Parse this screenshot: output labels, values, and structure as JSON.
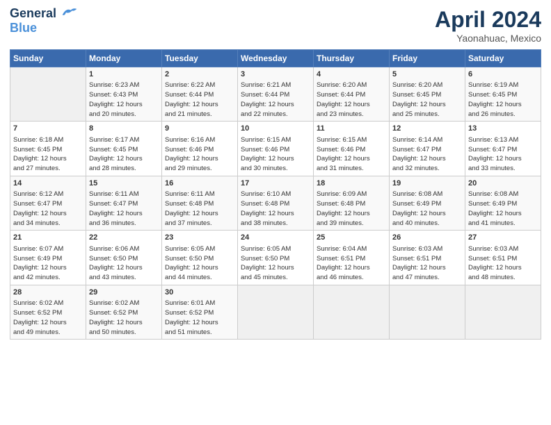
{
  "header": {
    "logo_line1": "General",
    "logo_line2": "Blue",
    "month_title": "April 2024",
    "location": "Yaonahuac, Mexico"
  },
  "days_of_week": [
    "Sunday",
    "Monday",
    "Tuesday",
    "Wednesday",
    "Thursday",
    "Friday",
    "Saturday"
  ],
  "weeks": [
    [
      {
        "day": "",
        "info": ""
      },
      {
        "day": "1",
        "info": "Sunrise: 6:23 AM\nSunset: 6:43 PM\nDaylight: 12 hours\nand 20 minutes."
      },
      {
        "day": "2",
        "info": "Sunrise: 6:22 AM\nSunset: 6:44 PM\nDaylight: 12 hours\nand 21 minutes."
      },
      {
        "day": "3",
        "info": "Sunrise: 6:21 AM\nSunset: 6:44 PM\nDaylight: 12 hours\nand 22 minutes."
      },
      {
        "day": "4",
        "info": "Sunrise: 6:20 AM\nSunset: 6:44 PM\nDaylight: 12 hours\nand 23 minutes."
      },
      {
        "day": "5",
        "info": "Sunrise: 6:20 AM\nSunset: 6:45 PM\nDaylight: 12 hours\nand 25 minutes."
      },
      {
        "day": "6",
        "info": "Sunrise: 6:19 AM\nSunset: 6:45 PM\nDaylight: 12 hours\nand 26 minutes."
      }
    ],
    [
      {
        "day": "7",
        "info": "Sunrise: 6:18 AM\nSunset: 6:45 PM\nDaylight: 12 hours\nand 27 minutes."
      },
      {
        "day": "8",
        "info": "Sunrise: 6:17 AM\nSunset: 6:45 PM\nDaylight: 12 hours\nand 28 minutes."
      },
      {
        "day": "9",
        "info": "Sunrise: 6:16 AM\nSunset: 6:46 PM\nDaylight: 12 hours\nand 29 minutes."
      },
      {
        "day": "10",
        "info": "Sunrise: 6:15 AM\nSunset: 6:46 PM\nDaylight: 12 hours\nand 30 minutes."
      },
      {
        "day": "11",
        "info": "Sunrise: 6:15 AM\nSunset: 6:46 PM\nDaylight: 12 hours\nand 31 minutes."
      },
      {
        "day": "12",
        "info": "Sunrise: 6:14 AM\nSunset: 6:47 PM\nDaylight: 12 hours\nand 32 minutes."
      },
      {
        "day": "13",
        "info": "Sunrise: 6:13 AM\nSunset: 6:47 PM\nDaylight: 12 hours\nand 33 minutes."
      }
    ],
    [
      {
        "day": "14",
        "info": "Sunrise: 6:12 AM\nSunset: 6:47 PM\nDaylight: 12 hours\nand 34 minutes."
      },
      {
        "day": "15",
        "info": "Sunrise: 6:11 AM\nSunset: 6:47 PM\nDaylight: 12 hours\nand 36 minutes."
      },
      {
        "day": "16",
        "info": "Sunrise: 6:11 AM\nSunset: 6:48 PM\nDaylight: 12 hours\nand 37 minutes."
      },
      {
        "day": "17",
        "info": "Sunrise: 6:10 AM\nSunset: 6:48 PM\nDaylight: 12 hours\nand 38 minutes."
      },
      {
        "day": "18",
        "info": "Sunrise: 6:09 AM\nSunset: 6:48 PM\nDaylight: 12 hours\nand 39 minutes."
      },
      {
        "day": "19",
        "info": "Sunrise: 6:08 AM\nSunset: 6:49 PM\nDaylight: 12 hours\nand 40 minutes."
      },
      {
        "day": "20",
        "info": "Sunrise: 6:08 AM\nSunset: 6:49 PM\nDaylight: 12 hours\nand 41 minutes."
      }
    ],
    [
      {
        "day": "21",
        "info": "Sunrise: 6:07 AM\nSunset: 6:49 PM\nDaylight: 12 hours\nand 42 minutes."
      },
      {
        "day": "22",
        "info": "Sunrise: 6:06 AM\nSunset: 6:50 PM\nDaylight: 12 hours\nand 43 minutes."
      },
      {
        "day": "23",
        "info": "Sunrise: 6:05 AM\nSunset: 6:50 PM\nDaylight: 12 hours\nand 44 minutes."
      },
      {
        "day": "24",
        "info": "Sunrise: 6:05 AM\nSunset: 6:50 PM\nDaylight: 12 hours\nand 45 minutes."
      },
      {
        "day": "25",
        "info": "Sunrise: 6:04 AM\nSunset: 6:51 PM\nDaylight: 12 hours\nand 46 minutes."
      },
      {
        "day": "26",
        "info": "Sunrise: 6:03 AM\nSunset: 6:51 PM\nDaylight: 12 hours\nand 47 minutes."
      },
      {
        "day": "27",
        "info": "Sunrise: 6:03 AM\nSunset: 6:51 PM\nDaylight: 12 hours\nand 48 minutes."
      }
    ],
    [
      {
        "day": "28",
        "info": "Sunrise: 6:02 AM\nSunset: 6:52 PM\nDaylight: 12 hours\nand 49 minutes."
      },
      {
        "day": "29",
        "info": "Sunrise: 6:02 AM\nSunset: 6:52 PM\nDaylight: 12 hours\nand 50 minutes."
      },
      {
        "day": "30",
        "info": "Sunrise: 6:01 AM\nSunset: 6:52 PM\nDaylight: 12 hours\nand 51 minutes."
      },
      {
        "day": "",
        "info": ""
      },
      {
        "day": "",
        "info": ""
      },
      {
        "day": "",
        "info": ""
      },
      {
        "day": "",
        "info": ""
      }
    ]
  ]
}
